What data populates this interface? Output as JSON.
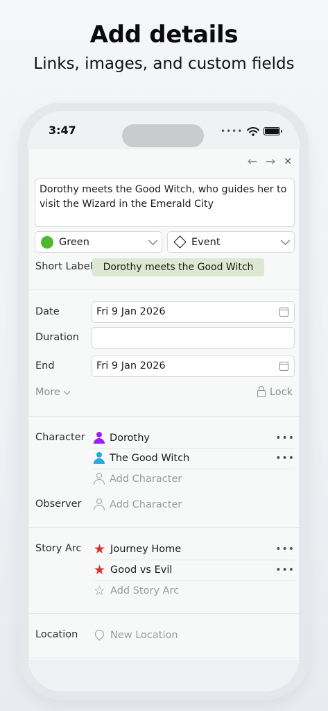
{
  "hero": {
    "title": "Add details",
    "subtitle": "Links, images, and custom fields"
  },
  "status_bar": {
    "time": "3:47",
    "signal": "••••",
    "wifi_icon": "wifi-icon",
    "battery_icon": "battery-icon"
  },
  "nav": {
    "back": "←",
    "forward": "→",
    "close": "✕"
  },
  "description": "Dorothy  meets the Good Witch, who guides her to visit the Wizard in the Emerald City",
  "color_select": {
    "value": "Green",
    "color": "#4fb82c"
  },
  "type_select": {
    "value": "Event"
  },
  "short_label": {
    "label": "Short Label",
    "value": "Dorothy  meets the Good Witch",
    "chip_color": "#dde8d2"
  },
  "dates": {
    "date_label": "Date",
    "date_value": "Fri 9 Jan 2026",
    "duration_label": "Duration",
    "duration_value": "",
    "end_label": "End",
    "end_value": "Fri 9 Jan 2026"
  },
  "more": {
    "label": "More"
  },
  "lock": {
    "label": "Lock"
  },
  "character": {
    "label": "Character",
    "items": [
      {
        "name": "Dorothy",
        "color": "#a020f0",
        "menu": "•••"
      },
      {
        "name": "The Good Witch",
        "color": "#29a8e0",
        "menu": "•••"
      }
    ],
    "add_label": "Add Character"
  },
  "observer": {
    "label": "Observer",
    "add_label": "Add Character"
  },
  "story_arc": {
    "label": "Story Arc",
    "items": [
      {
        "name": "Journey Home",
        "color": "#d9302c",
        "menu": "•••"
      },
      {
        "name": "Good vs Evil",
        "color": "#d9302c",
        "menu": "•••"
      }
    ],
    "add_label": "Add Story Arc"
  },
  "location": {
    "label": "Location",
    "add_label": "New Location"
  }
}
